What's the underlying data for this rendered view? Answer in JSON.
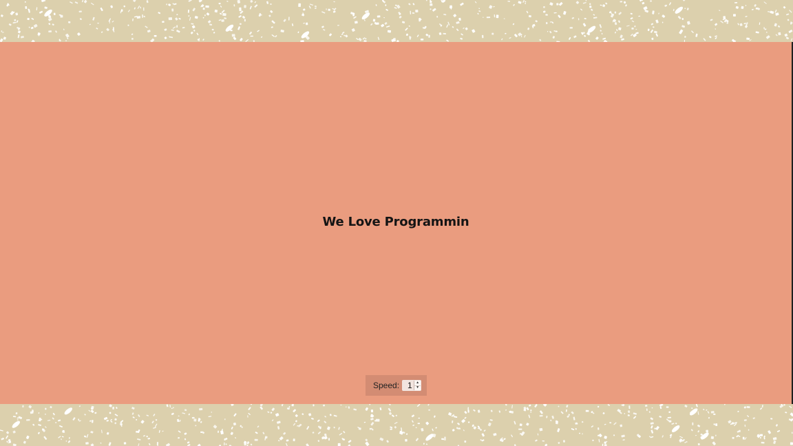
{
  "colors": {
    "background_pattern": "#dcd0ad",
    "pattern_flecks": "#ffffff",
    "stage": "#ea9c7f",
    "speed_panel": "#d38c73",
    "title_text": "#141414"
  },
  "stage": {
    "title": "We Love Programmin"
  },
  "speed_control": {
    "label": "Speed:",
    "value": "1",
    "spin_up_icon": "triangle-up",
    "spin_down_icon": "triangle-down"
  }
}
